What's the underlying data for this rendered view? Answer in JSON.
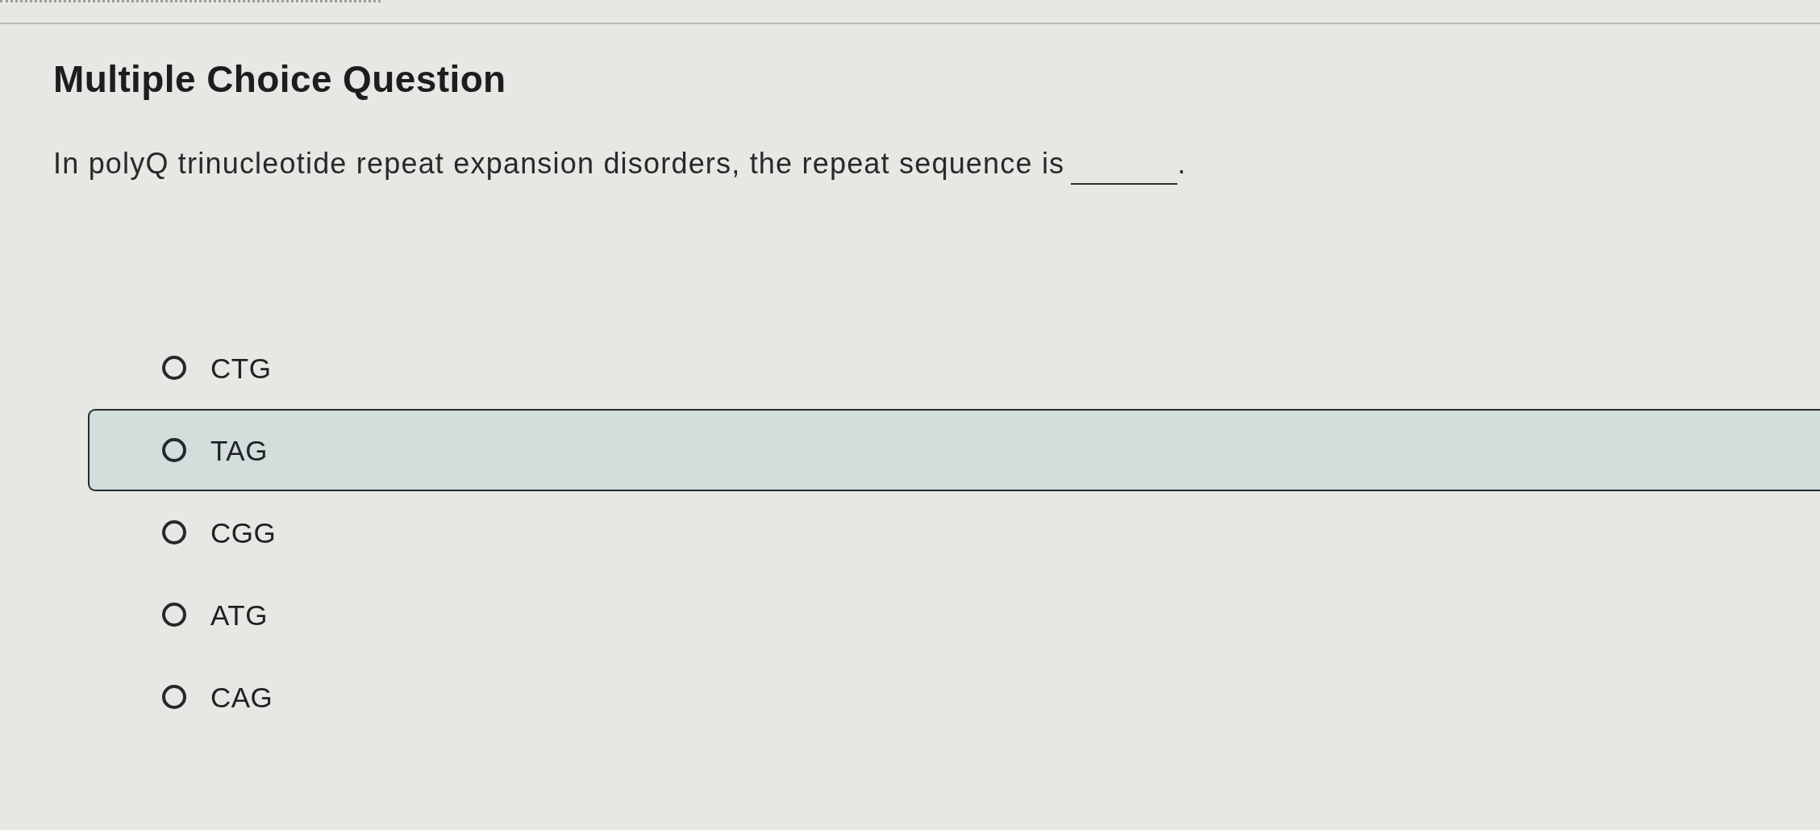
{
  "header": {
    "title": "Multiple Choice Question"
  },
  "question": {
    "text": "In polyQ trinucleotide repeat expansion disorders, the repeat sequence is",
    "after_blank": "."
  },
  "options": [
    {
      "label": "CTG",
      "selected": false,
      "hovered": false
    },
    {
      "label": "TAG",
      "selected": false,
      "hovered": true
    },
    {
      "label": "CGG",
      "selected": false,
      "hovered": false
    },
    {
      "label": "ATG",
      "selected": false,
      "hovered": false
    },
    {
      "label": "CAG",
      "selected": false,
      "hovered": false
    }
  ]
}
